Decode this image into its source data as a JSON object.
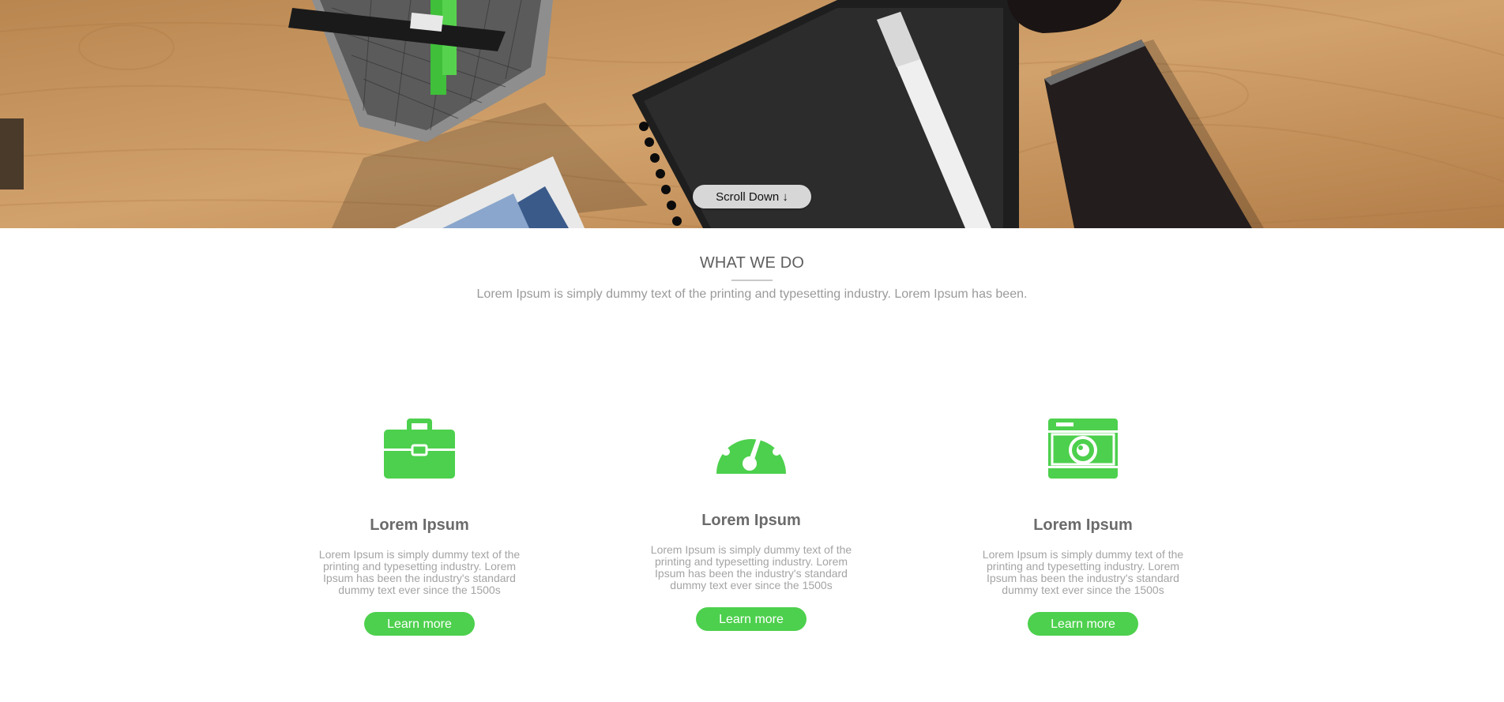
{
  "hero": {
    "scroll_label": "Scroll Down ↓"
  },
  "section": {
    "title": "WHAT WE DO",
    "subtitle": "Lorem Ipsum is simply dummy text of the printing and typesetting industry. Lorem Ipsum has been."
  },
  "colors": {
    "accent": "#4dd04d",
    "title": "#6b6b6b",
    "muted": "#a4a4a4"
  },
  "cards": [
    {
      "icon": "briefcase-icon",
      "title": "Lorem Ipsum",
      "text": "Lorem Ipsum is simply dummy text of the printing and typesetting industry. Lorem Ipsum has been the industry's standard dummy text ever since the 1500s",
      "button": "Learn more"
    },
    {
      "icon": "dashboard-icon",
      "title": "Lorem Ipsum",
      "text": "Lorem Ipsum is simply dummy text of the printing and typesetting industry. Lorem Ipsum has been the industry's standard dummy text ever since the 1500s",
      "button": "Learn more"
    },
    {
      "icon": "camera-icon",
      "title": "Lorem Ipsum",
      "text": "Lorem Ipsum is simply dummy text of the printing and typesetting industry. Lorem Ipsum has been the industry's standard dummy text ever since the 1500s",
      "button": "Learn more"
    }
  ]
}
